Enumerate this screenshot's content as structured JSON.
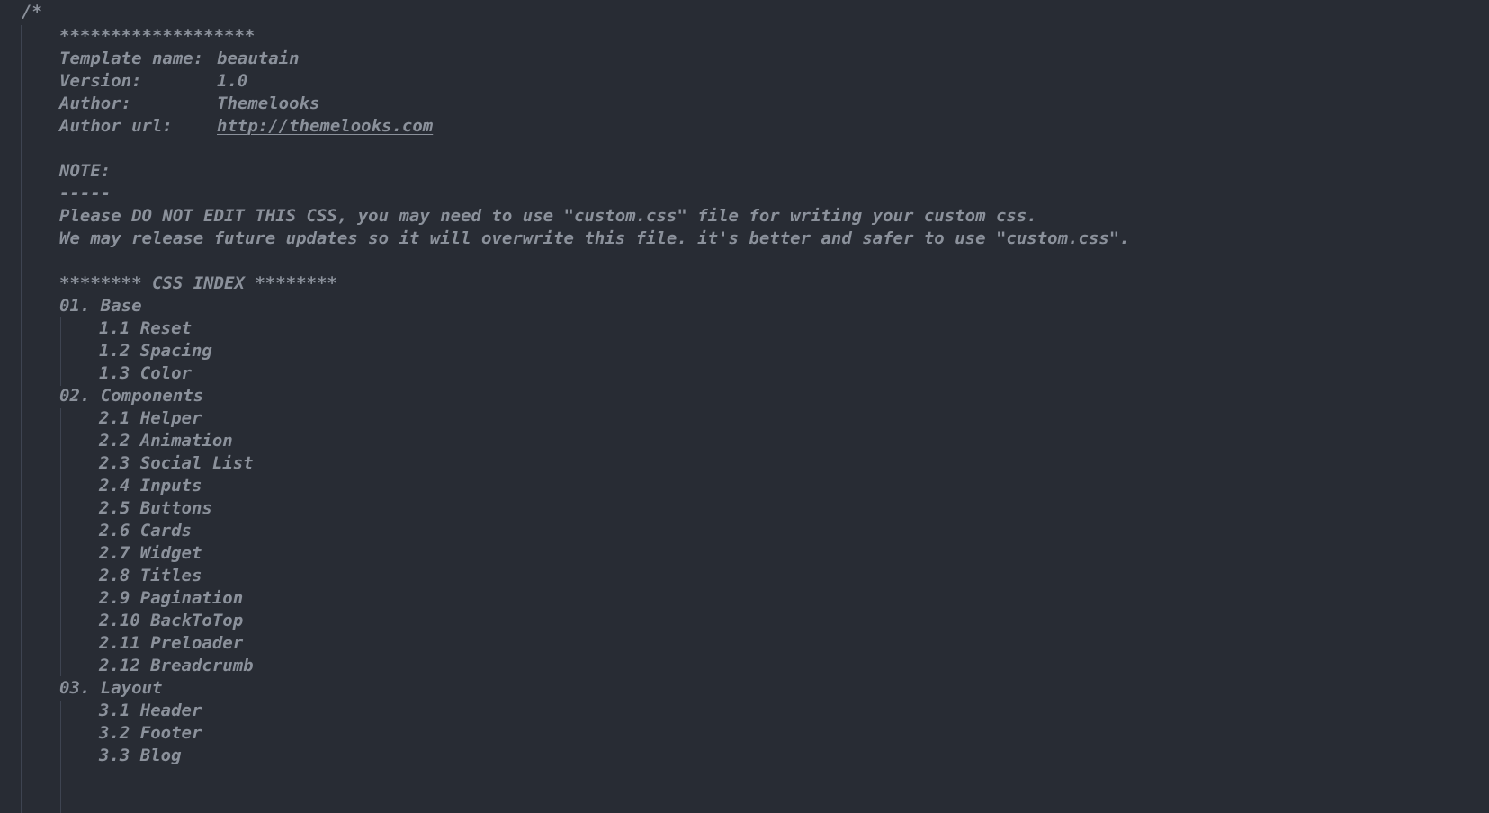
{
  "editor": {
    "comment_open": "/*",
    "stars_line": "*******************",
    "header": {
      "template_label": "Template name:",
      "template_value": "beautain",
      "version_label": "Version:",
      "version_value": "1.0",
      "author_label": "Author:",
      "author_value": "Themelooks",
      "author_url_label": "Author url:",
      "author_url_value": "http://themelooks.com"
    },
    "note": {
      "title": "NOTE:",
      "underline": "-----",
      "line1": "Please DO NOT EDIT THIS CSS, you may need to use \"custom.css\" file for writing your custom css.",
      "line2": "We may release future updates so it will overwrite this file. it's better and safer to use \"custom.css\"."
    },
    "index_title": "******** CSS INDEX ********",
    "index": [
      {
        "label": "01. Base",
        "items": [
          "1.1 Reset",
          "1.2 Spacing",
          "1.3 Color"
        ]
      },
      {
        "label": "02. Components",
        "items": [
          "2.1 Helper",
          "2.2 Animation",
          "2.3 Social List",
          "2.4 Inputs",
          "2.5 Buttons",
          "2.6 Cards",
          "2.7 Widget",
          "2.8 Titles",
          "2.9 Pagination",
          "2.10 BackToTop",
          "2.11 Preloader",
          "2.12 Breadcrumb"
        ]
      },
      {
        "label": "03. Layout",
        "items": [
          "3.1 Header",
          "3.2 Footer",
          "3.3 Blog"
        ]
      }
    ]
  }
}
